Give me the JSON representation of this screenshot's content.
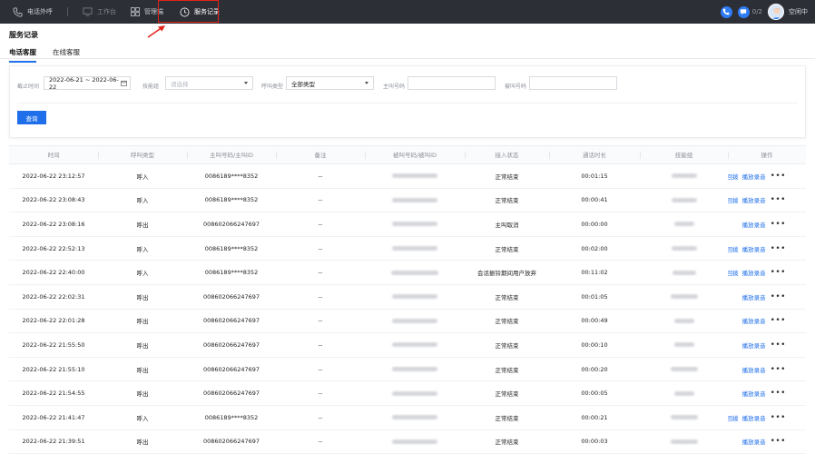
{
  "topbar": {
    "nav": [
      {
        "label": "电话外呼",
        "icon": "phone-icon"
      },
      {
        "label": "工作台",
        "icon": "monitor-icon"
      },
      {
        "label": "管理端",
        "icon": "grid-icon"
      },
      {
        "label": "服务记录",
        "icon": "clock-icon"
      }
    ],
    "counter": "0/2",
    "status": "空闲中",
    "accent": "#2f7cf6",
    "highlight": "#e2231a"
  },
  "page": {
    "title": "服务记录",
    "tabs": [
      "电话客服",
      "在线客服"
    ]
  },
  "filters": {
    "time_label": "截止时间",
    "time_value": "2022-06-21 ~ 2022-06-22",
    "group_label": "技能组",
    "group_placeholder": "请选择",
    "type_label": "呼叫类型",
    "type_value": "全部类型",
    "caller_label": "主叫号码",
    "callee_label": "被叫号码",
    "query_button": "查询"
  },
  "table": {
    "headers": [
      "时间",
      "呼叫类型",
      "主叫号码/主叫ID",
      "备注",
      "被叫号码/被叫ID",
      "接入状态",
      "通话时长",
      "技能组",
      "操作"
    ],
    "callback_label": "回拨",
    "play_label": "播放录音",
    "rows": [
      {
        "time": "2022-06-22 23:12:57",
        "type": "呼入",
        "caller": "0086189****8352",
        "note": "--",
        "status": "正常结束",
        "duration": "00:01:15",
        "callback": true
      },
      {
        "time": "2022-06-22 23:08:43",
        "type": "呼入",
        "caller": "0086189****8352",
        "note": "--",
        "status": "正常结束",
        "duration": "00:00:41",
        "callback": true
      },
      {
        "time": "2022-06-22 23:08:16",
        "type": "呼出",
        "caller": "008602066247697",
        "note": "--",
        "status": "主叫取消",
        "duration": "00:00:00",
        "callback": false
      },
      {
        "time": "2022-06-22 22:52:13",
        "type": "呼入",
        "caller": "0086189****8352",
        "note": "--",
        "status": "正常结束",
        "duration": "00:02:00",
        "callback": true
      },
      {
        "time": "2022-06-22 22:40:00",
        "type": "呼入",
        "caller": "0086189****8352",
        "note": "--",
        "status": "会话振铃期间用户放弃",
        "duration": "00:11:02",
        "callback": true
      },
      {
        "time": "2022-06-22 22:02:31",
        "type": "呼出",
        "caller": "008602066247697",
        "note": "--",
        "status": "正常结束",
        "duration": "00:01:05",
        "callback": false
      },
      {
        "time": "2022-06-22 22:01:28",
        "type": "呼出",
        "caller": "008602066247697",
        "note": "--",
        "status": "正常结束",
        "duration": "00:00:49",
        "callback": false
      },
      {
        "time": "2022-06-22 21:55:50",
        "type": "呼出",
        "caller": "008602066247697",
        "note": "--",
        "status": "正常结束",
        "duration": "00:00:10",
        "callback": false
      },
      {
        "time": "2022-06-22 21:55:10",
        "type": "呼出",
        "caller": "008602066247697",
        "note": "--",
        "status": "正常结束",
        "duration": "00:00:20",
        "callback": false
      },
      {
        "time": "2022-06-22 21:54:55",
        "type": "呼出",
        "caller": "008602066247697",
        "note": "--",
        "status": "正常结束",
        "duration": "00:00:05",
        "callback": false
      },
      {
        "time": "2022-06-22 21:41:47",
        "type": "呼入",
        "caller": "0086189****8352",
        "note": "--",
        "status": "正常结束",
        "duration": "00:00:21",
        "callback": true
      },
      {
        "time": "2022-06-22 21:39:51",
        "type": "呼出",
        "caller": "008602066247697",
        "note": "--",
        "status": "正常结束",
        "duration": "00:00:03",
        "callback": false
      }
    ]
  }
}
